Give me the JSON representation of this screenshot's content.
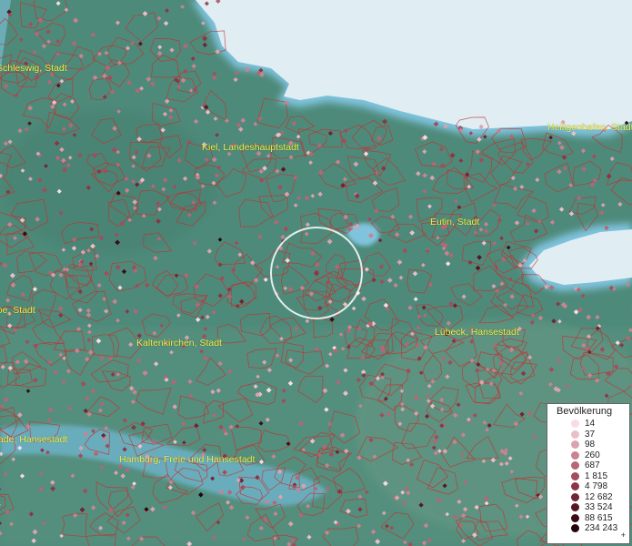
{
  "legend": {
    "title": "Bevölkerung",
    "plus": "+",
    "items": [
      {
        "label": "14",
        "color": "#f7dce3"
      },
      {
        "label": "37",
        "color": "#ebbfca"
      },
      {
        "label": "98",
        "color": "#dba3b0"
      },
      {
        "label": "260",
        "color": "#c98391"
      },
      {
        "label": "687",
        "color": "#b76676"
      },
      {
        "label": "1 815",
        "color": "#a34c5c"
      },
      {
        "label": "4 798",
        "color": "#8b3545"
      },
      {
        "label": "12 682",
        "color": "#712433"
      },
      {
        "label": "33 524",
        "color": "#571623"
      },
      {
        "label": "88 615",
        "color": "#3b0c16"
      },
      {
        "label": "234 243",
        "color": "#22050b"
      }
    ]
  },
  "cities": [
    {
      "name": "Schleswig, Stadt"
    },
    {
      "name": "Kiel, Landeshauptstadt"
    },
    {
      "name": "Heiligenhafen, Stadt"
    },
    {
      "name": "Eutin, Stadt"
    },
    {
      "name": "Itzehoe, Stadt"
    },
    {
      "name": "Kaltenkirchen, Stadt"
    },
    {
      "name": "Lübeck, Hansestadt"
    },
    {
      "name": "Hamburg, Freie und Hansestadt"
    },
    {
      "name": "Stade, Hansestadt"
    }
  ],
  "colors": {
    "land": "#4e8a7a",
    "sea": "#e0eef4",
    "border": "#cc2b2b",
    "label": "#f4f24a"
  }
}
